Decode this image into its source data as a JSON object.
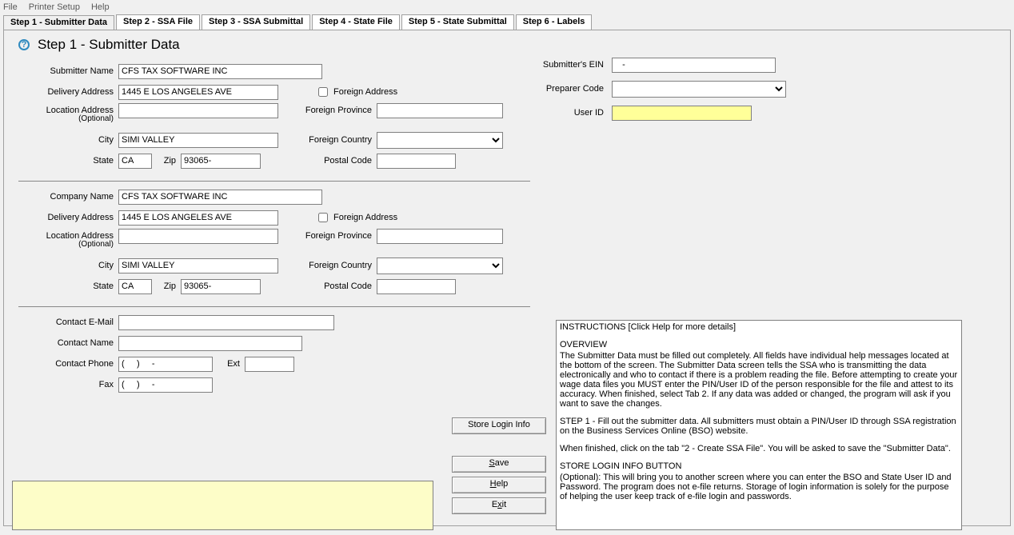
{
  "menu": {
    "file": "File",
    "printer_setup": "Printer Setup",
    "help": "Help"
  },
  "tabs": [
    {
      "label": "Step 1 - Submitter Data"
    },
    {
      "label": "Step 2 - SSA File"
    },
    {
      "label": "Step 3 - SSA Submittal"
    },
    {
      "label": "Step 4 - State File"
    },
    {
      "label": "Step 5 - State Submittal"
    },
    {
      "label": "Step 6 - Labels"
    }
  ],
  "page": {
    "title": "Step 1 - Submitter Data"
  },
  "sub": {
    "name_label": "Submitter Name",
    "name": "CFS TAX SOFTWARE INC",
    "daddr_label": "Delivery Address",
    "daddr": "1445 E LOS ANGELES AVE",
    "laddr_label": "Location Address",
    "laddr_optional": "(Optional)",
    "laddr": "",
    "city_label": "City",
    "city": "SIMI VALLEY",
    "state_label": "State",
    "state": "CA",
    "zip_label": "Zip",
    "zip": "93065-",
    "foreign_chk": "Foreign Address",
    "fprov_label": "Foreign Province",
    "fprov": "",
    "fctry_label": "Foreign Country",
    "pcode_label": "Postal Code",
    "pcode": ""
  },
  "co": {
    "name_label": "Company Name",
    "name": "CFS TAX SOFTWARE INC",
    "daddr_label": "Delivery Address",
    "daddr": "1445 E LOS ANGELES AVE",
    "laddr_label": "Location Address",
    "laddr_optional": "(Optional)",
    "laddr": "",
    "city_label": "City",
    "city": "SIMI VALLEY",
    "state_label": "State",
    "state": "CA",
    "zip_label": "Zip",
    "zip": "93065-",
    "foreign_chk": "Foreign Address",
    "fprov_label": "Foreign Province",
    "fprov": "",
    "fctry_label": "Foreign Country",
    "pcode_label": "Postal Code",
    "pcode": ""
  },
  "contact": {
    "email_label": "Contact E-Mail",
    "email": "",
    "name_label": "Contact Name",
    "name": "",
    "phone_label": "Contact Phone",
    "phone": "(     )     -",
    "ext_label": "Ext",
    "ext": "",
    "fax_label": "Fax",
    "fax": "(     )     -"
  },
  "right": {
    "ein_label": "Submitter's EIN",
    "ein": "   -",
    "prep_label": "Preparer Code",
    "uid_label": "User ID",
    "uid": ""
  },
  "buttons": {
    "store": "Store Login Info",
    "save": "Save",
    "help": "Help",
    "exit": "Exit"
  },
  "instructions": {
    "l1": "INSTRUCTIONS [Click Help for more details]",
    "l2": "OVERVIEW",
    "l3": "The Submitter Data must be filled out completely.  All fields have individual help messages located at the bottom of the screen.  The Submitter Data screen tells the SSA who is transmitting the data electronically and who to contact if there is a problem reading the file.  Before attempting to create your wage data files you MUST enter the PIN/User ID of the person responsible for the file and attest to its accuracy.  When finished, select Tab 2.  If any data was added or changed, the program will ask if you want to save the changes.",
    "l4": "STEP 1 - Fill out the submitter data.  All submitters must obtain a PIN/User ID through SSA registration on the Business Services Online (BSO) website.",
    "l5": "When finished, click on the tab \"2 - Create SSA File\".  You will be asked to save the \"Submitter Data\".",
    "l6": "STORE LOGIN INFO BUTTON",
    "l7": "(Optional): This will bring you to another screen where you can enter the BSO and State User ID and Password.  The program does not e-file returns.  Storage of login information is solely for the purpose of helping the user keep track of e-file login and passwords."
  }
}
